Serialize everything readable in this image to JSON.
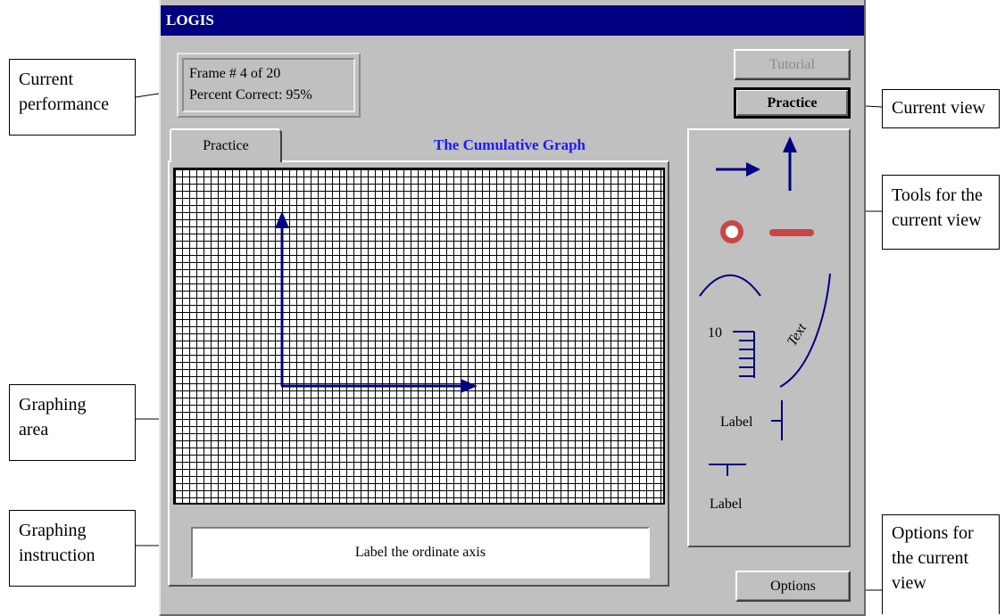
{
  "window": {
    "title": "LOGIS"
  },
  "performance": {
    "frame": "Frame # 4 of 20",
    "percent": "Percent Correct: 95%"
  },
  "buttons": {
    "tutorial": "Tutorial",
    "practice": "Practice",
    "options": "Options"
  },
  "tab": {
    "label": "Practice"
  },
  "graph": {
    "title": "The Cumulative Graph",
    "instruction": "Label the ordinate axis"
  },
  "tools": {
    "scale_number": "10",
    "curve_text": "Text",
    "vertical_label": "Label",
    "horizontal_label": "Label"
  },
  "callouts": {
    "current_performance": "Current\nperformance",
    "graphing_area": "Graphing\narea",
    "graphing_instruction": "Graphing\ninstruction",
    "current_view": "Current view",
    "tools_view": "Tools for the\ncurrent view",
    "options_view": "Options for\nthe current\nview"
  },
  "colors": {
    "titlebar": "#000080",
    "graph_title": "#1a1aff",
    "tool_red": "#c84646",
    "tool_blue": "#000080"
  }
}
